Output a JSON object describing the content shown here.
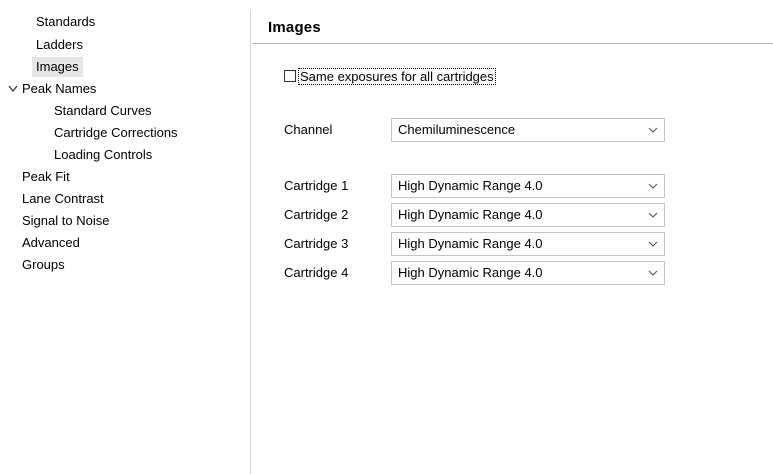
{
  "sidebar": {
    "items": [
      {
        "label": "Standards"
      },
      {
        "label": "Ladders"
      },
      {
        "label": "Images"
      },
      {
        "label": "Peak Names"
      },
      {
        "label": "Standard Curves"
      },
      {
        "label": "Cartridge Corrections"
      },
      {
        "label": "Loading Controls"
      },
      {
        "label": "Peak Fit"
      },
      {
        "label": "Lane Contrast"
      },
      {
        "label": "Signal to Noise"
      },
      {
        "label": "Advanced"
      },
      {
        "label": "Groups"
      }
    ],
    "selected": "Images",
    "expanded_icon": "chevron-down-icon"
  },
  "main": {
    "title": "Images",
    "same_exposures": {
      "label": "Same exposures for all cartridges",
      "checked": false
    },
    "channel": {
      "label": "Channel",
      "value": "Chemiluminescence"
    },
    "cartridges": [
      {
        "label": "Cartridge 1",
        "value": "High Dynamic Range 4.0"
      },
      {
        "label": "Cartridge 2",
        "value": "High Dynamic Range 4.0"
      },
      {
        "label": "Cartridge 3",
        "value": "High Dynamic Range 4.0"
      },
      {
        "label": "Cartridge 4",
        "value": "High Dynamic Range 4.0"
      }
    ]
  }
}
